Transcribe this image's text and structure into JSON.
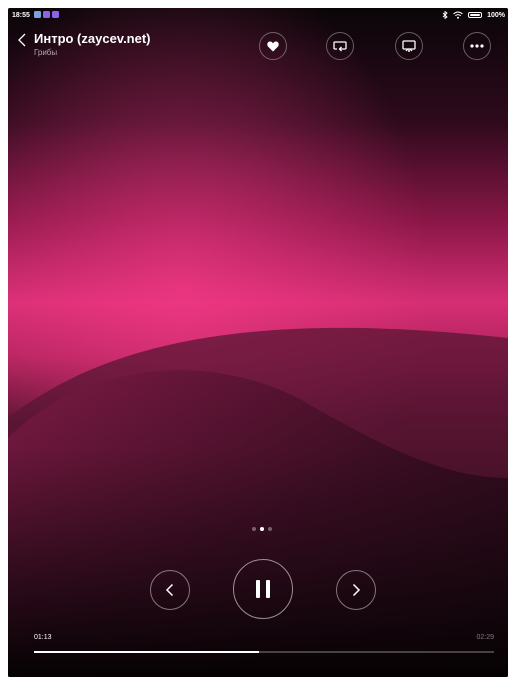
{
  "status_bar": {
    "time": "18:55",
    "battery": "100%",
    "icons": [
      "bluetooth-icon",
      "wifi-icon",
      "battery-icon"
    ],
    "app_icons": [
      "gallery-icon",
      "app-icon",
      "app-icon"
    ]
  },
  "header": {
    "title": "Интро (zaycev.net)",
    "subtitle": "Грибы",
    "actions": [
      "heart-icon",
      "repeat-icon",
      "cast-icon",
      "more-icon"
    ]
  },
  "pager": {
    "pages": 3,
    "active": 1
  },
  "controls": {
    "previous": "chevron-left-icon",
    "play_pause": "pause-icon",
    "next": "chevron-right-icon"
  },
  "progress": {
    "elapsed": "01:13",
    "total": "02:29",
    "fraction": 0.49
  },
  "colors": {
    "accent": "#e5307b",
    "background": "#0b0408"
  }
}
